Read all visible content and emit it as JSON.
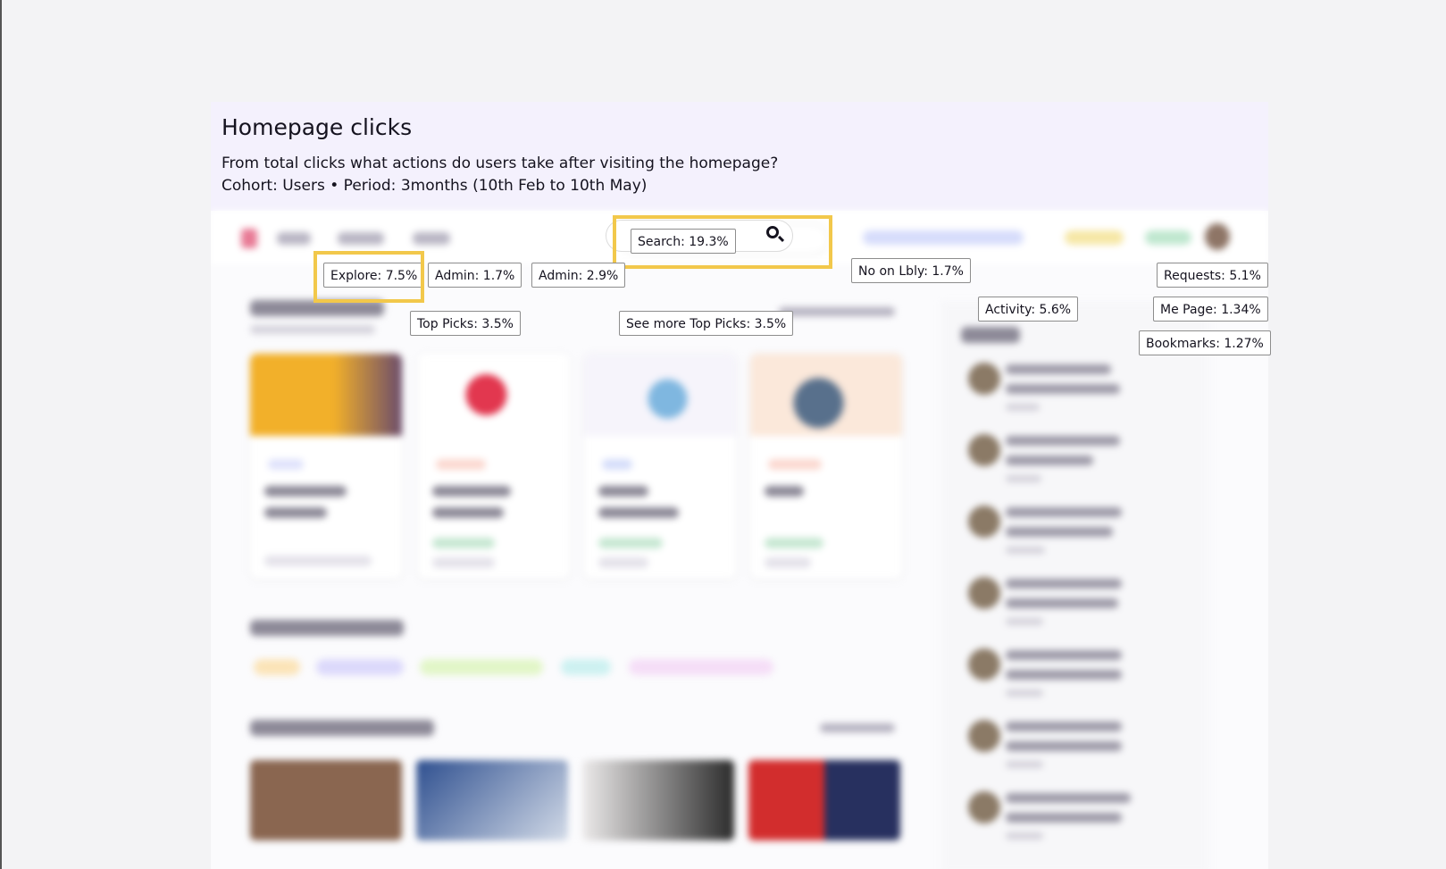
{
  "header": {
    "title": "Homepage clicks",
    "subtitle": "From total clicks what actions do users take after visiting the homepage?",
    "cohort": "Cohort: Users • Period: 3months (10th Feb to 10th May)"
  },
  "icons": {
    "search": "search-icon"
  },
  "colors": {
    "highlight": "#f2c84b",
    "header_bg": "#f4f1fd"
  },
  "tags": {
    "search": "Search: 19.3%",
    "explore": "Explore: 7.5%",
    "admin1": "Admin: 1.7%",
    "admin2": "Admin: 2.9%",
    "no_on_lbly": "No on Lbly: 1.7%",
    "requests": "Requests: 5.1%",
    "activity": "Activity: 5.6%",
    "me_page": "Me Page: 1.34%",
    "bookmarks": "Bookmarks: 1.27%",
    "top_picks": "Top Picks: 3.5%",
    "see_more_top_picks": "See more Top Picks: 3.5%"
  }
}
